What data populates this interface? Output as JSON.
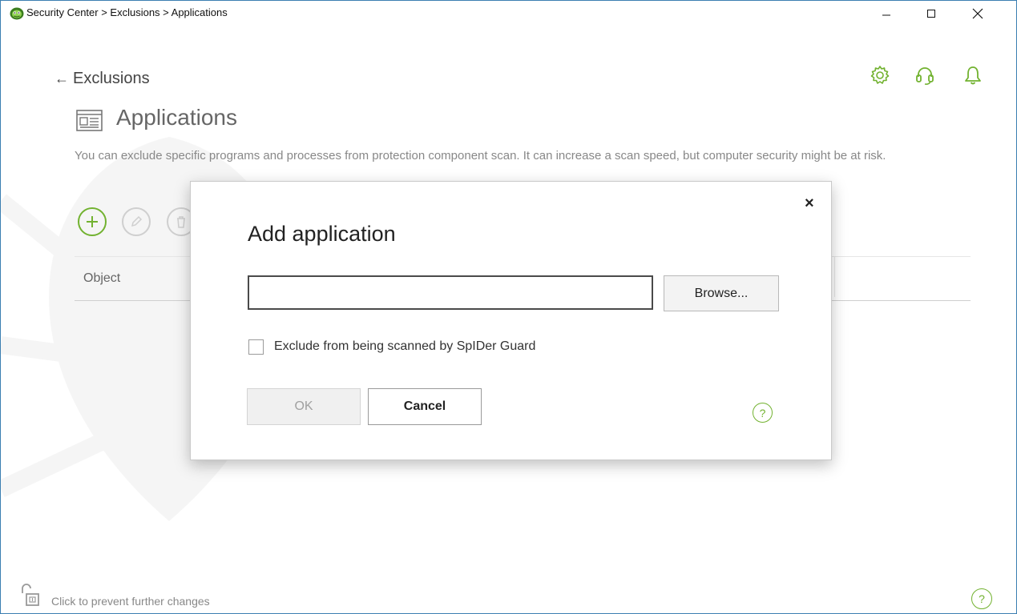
{
  "window": {
    "title": "Security Center > Exclusions > Applications",
    "controls": {
      "minimize": "minimize-icon",
      "maximize": "maximize-icon",
      "close": "close-icon"
    }
  },
  "header": {
    "back_label": "Exclusions",
    "icons": [
      "gear-icon",
      "headset-icon",
      "bell-icon"
    ]
  },
  "page": {
    "title": "Applications",
    "description": "You can exclude specific programs and processes from protection component scan. It can increase a scan speed, but computer security might be at risk."
  },
  "toolbar": {
    "add_icon": "plus-icon",
    "edit_icon": "pencil-icon",
    "delete_icon": "trash-icon"
  },
  "table": {
    "columns": [
      "Object"
    ],
    "rows": []
  },
  "footer": {
    "lock_text": "Click to prevent further changes",
    "help_label": "?"
  },
  "modal": {
    "title": "Add application",
    "close_label": "×",
    "path_input": {
      "value": "",
      "placeholder": ""
    },
    "browse_label": "Browse...",
    "checkbox": {
      "label": "Exclude from being scanned by SpIDer Guard",
      "checked": false
    },
    "ok_label": "OK",
    "ok_enabled": false,
    "cancel_label": "Cancel",
    "help_label": "?"
  },
  "colors": {
    "accent": "#72b230",
    "window_border": "#3c7fb1",
    "disabled_text": "#a0a0a0"
  }
}
